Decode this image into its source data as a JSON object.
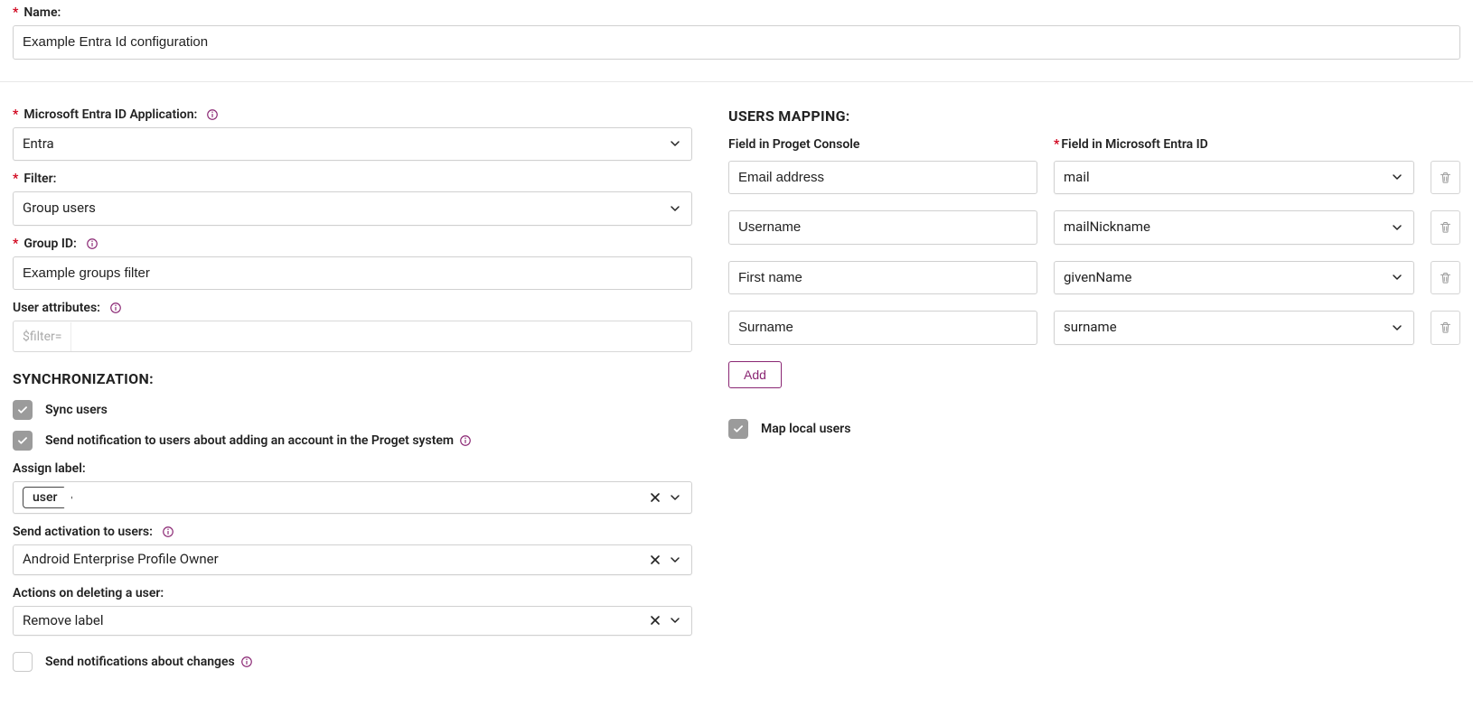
{
  "top": {
    "name_label": "Name:",
    "name_value": "Example Entra Id configuration"
  },
  "left": {
    "app_label": "Microsoft Entra ID Application:",
    "app_value": "Entra",
    "filter_label": "Filter:",
    "filter_value": "Group users",
    "group_id_label": "Group ID:",
    "group_id_value": "Example groups filter",
    "user_attr_label": "User attributes:",
    "user_attr_prefix": "$filter=",
    "user_attr_value": "",
    "sync_heading": "SYNCHRONIZATION:",
    "sync_users_label": "Sync users",
    "notify_add_label": "Send notification to users about adding an account in the Proget system",
    "assign_label_label": "Assign label:",
    "assign_label_tag": "user",
    "send_activation_label": "Send activation to users:",
    "send_activation_value": "Android Enterprise Profile Owner",
    "actions_delete_label": "Actions on deleting a user:",
    "actions_delete_value": "Remove label",
    "notify_changes_label": "Send notifications about changes"
  },
  "right": {
    "heading": "USERS MAPPING:",
    "col_left_head": "Field in Proget Console",
    "col_right_head": "Field in Microsoft Entra ID",
    "rows": [
      {
        "proget": "Email address",
        "entra": "mail"
      },
      {
        "proget": "Username",
        "entra": "mailNickname"
      },
      {
        "proget": "First name",
        "entra": "givenName"
      },
      {
        "proget": "Surname",
        "entra": "surname"
      }
    ],
    "add_label": "Add",
    "map_local_label": "Map local users"
  }
}
